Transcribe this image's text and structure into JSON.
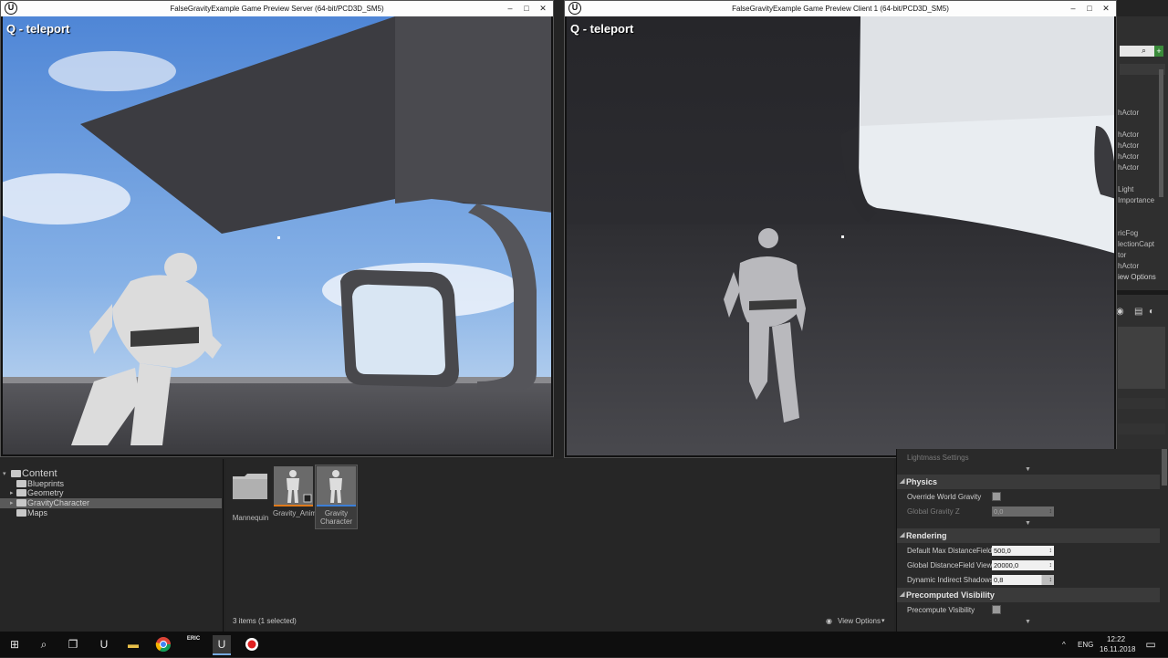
{
  "server_window": {
    "title": "FalseGravityExample Game Preview Server (64-bit/PCD3D_SM5)",
    "hud_text": "Q - teleport"
  },
  "client_window": {
    "title": "FalseGravityExample Game Preview Client 1 (64-bit/PCD3D_SM5)",
    "hud_text": "Q - teleport"
  },
  "window_buttons": {
    "minimize": "–",
    "maximize": "□",
    "close": "✕"
  },
  "outliner_strip": {
    "items": [
      "hActor",
      "hActor",
      "hActor",
      "hActor",
      "hActor",
      "Light",
      "Importance",
      "ricFog",
      "lectionCapt",
      "tor",
      "hActor"
    ],
    "view_options": "iew Options"
  },
  "content_tree": {
    "root": "Content",
    "children": [
      "Blueprints",
      "Geometry",
      "GravityCharacter",
      "Maps"
    ],
    "selected": "GravityCharacter"
  },
  "assets": [
    {
      "label": "Mannequin",
      "kind": "folder"
    },
    {
      "label": "Gravity_AnimBP",
      "kind": "anim-blueprint"
    },
    {
      "label": "Gravity Character",
      "kind": "blueprint"
    }
  ],
  "status": {
    "items_text": "3 items (1 selected)",
    "view_options": "View Options"
  },
  "details": {
    "truncated_row": "Lightmass Settings",
    "physics": {
      "header": "Physics",
      "override_world_gravity": "Override World Gravity",
      "global_gravity_z_label": "Global Gravity Z",
      "global_gravity_z_value": "0,0"
    },
    "rendering": {
      "header": "Rendering",
      "max_distance_label": "Default Max DistanceField",
      "max_distance_value": "500,0",
      "global_view_label": "Global DistanceField View",
      "global_view_value": "20000,0",
      "indirect_shadows_label": "Dynamic Indirect Shadows",
      "indirect_shadows_value": "0,8"
    },
    "precomputed": {
      "header": "Precomputed Visibility",
      "precompute_label": "Precompute Visibility"
    }
  },
  "taskbar": {
    "language": "ENG",
    "time": "12:22",
    "date": "16.11.2018",
    "apps": [
      "start",
      "search",
      "task-view",
      "unreal-launcher",
      "file-explorer",
      "chrome",
      "eric",
      "unreal-editor",
      "record"
    ],
    "eric_label": "ERIC"
  },
  "colors": {
    "sky": "#5c8fd6",
    "floor": "#3d3d40",
    "selection": "#5a5a5a"
  }
}
